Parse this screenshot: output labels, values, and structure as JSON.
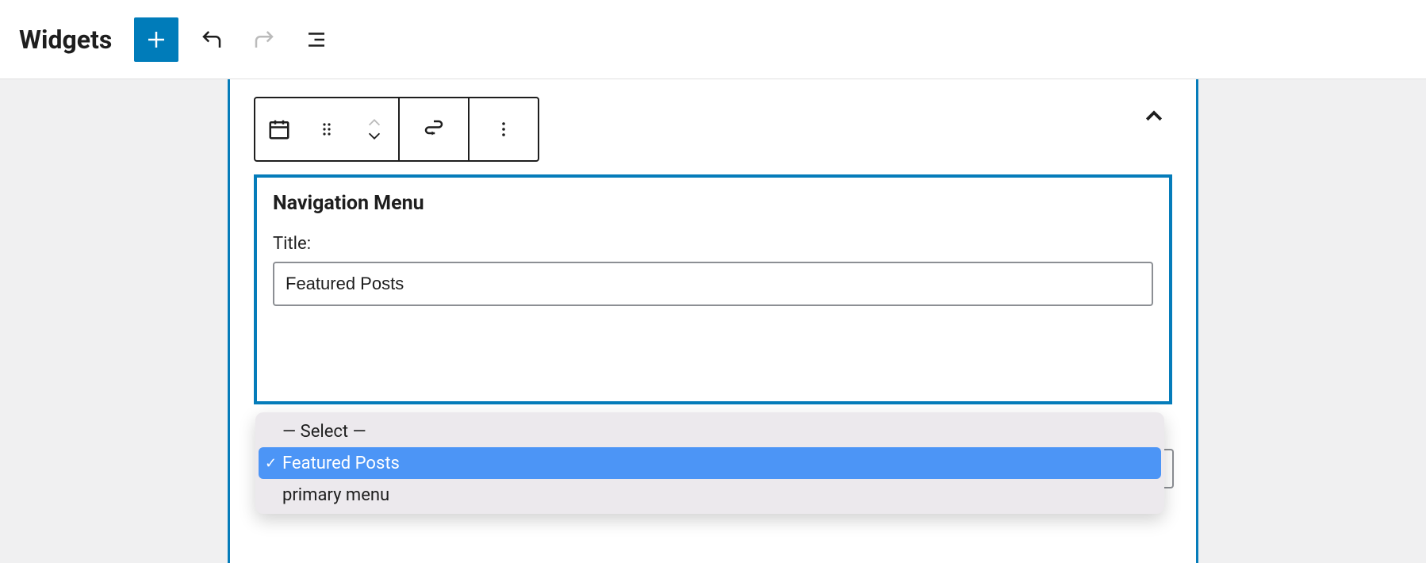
{
  "header": {
    "title": "Widgets"
  },
  "block": {
    "heading": "Navigation Menu",
    "title_label": "Title:",
    "title_value": "Featured Posts"
  },
  "dropdown": {
    "options": [
      {
        "label": "— Select —",
        "selected": false
      },
      {
        "label": "Featured Posts",
        "selected": true
      },
      {
        "label": "primary menu",
        "selected": false
      }
    ]
  }
}
